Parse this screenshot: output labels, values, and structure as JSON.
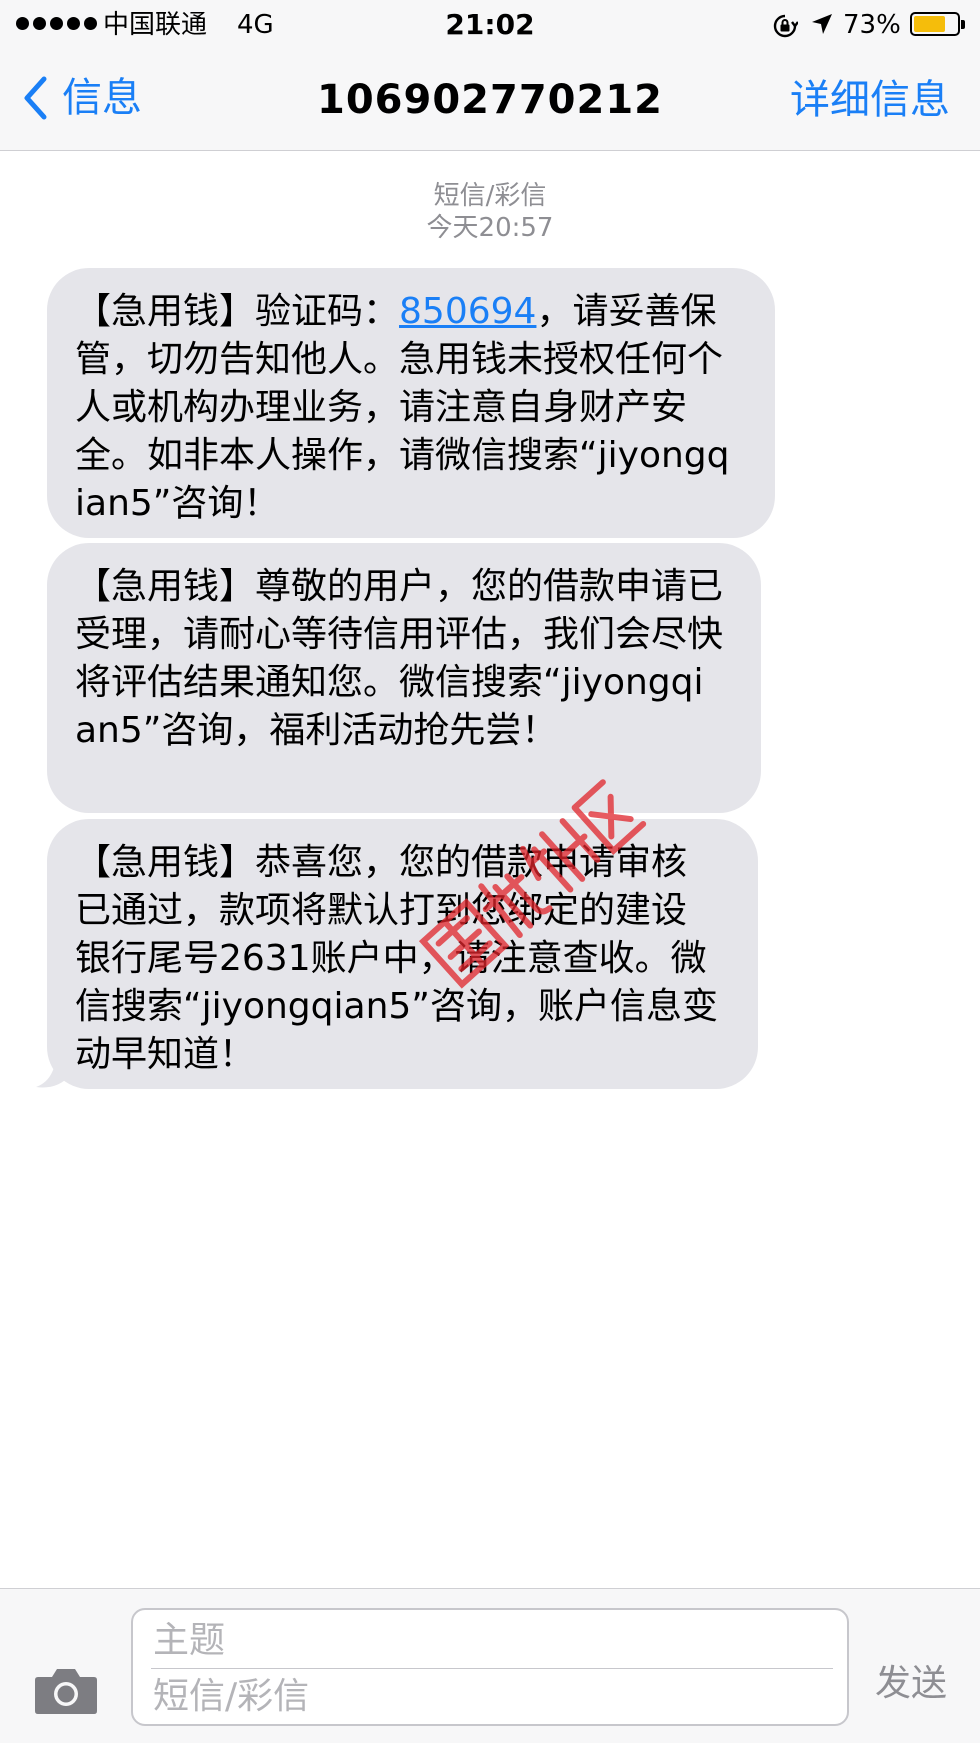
{
  "status_bar": {
    "carrier": "中国联通",
    "network": "4G",
    "time": "21:02",
    "battery_percent": "73%",
    "battery_level": 0.73,
    "signal_bars": 5,
    "icons": [
      "signal-dots-icon",
      "rotation-lock-icon",
      "location-arrow-icon",
      "battery-icon"
    ]
  },
  "nav": {
    "back_label": "信息",
    "title": "106902770212",
    "details_label": "详细信息",
    "accent_color": "#1a7ff6"
  },
  "thread": {
    "type_label": "短信/彩信",
    "timestamp": "今天20:57"
  },
  "messages": [
    {
      "prefix": "【急用钱】验证码：",
      "code": "850694",
      "suffix": "，请妥善保管，切勿告知他人。急用钱未授权任何个人或机构办理业务，请注意自身财产安全。如非本人操作，请微信搜索“jiyongqian5”咨询！"
    },
    {
      "text": "【急用钱】尊敬的用户，您的借款申请已受理，请耐心等待信用评估，我们会尽快将评估结果通知您。微信搜索“jiyongqian5”咨询，福利活动抢先尝！"
    },
    {
      "text": "【急用钱】恭喜您，您的借款申请审核已通过，款项将默认打到您绑定的建设银行尾号2631账户中，请注意查收。微信搜索“jiyongqian5”咨询，账户信息变动早知道！"
    }
  ],
  "composer": {
    "subject_placeholder": "主题",
    "message_placeholder": "短信/彩信",
    "send_label": "发送"
  },
  "colors": {
    "bubble_bg": "#e5e5ea",
    "header_bg": "#f7f7f8",
    "meta_text": "#8e8e93",
    "battery_fill": "#f5bd0b",
    "watermark": "#e0242b"
  }
}
